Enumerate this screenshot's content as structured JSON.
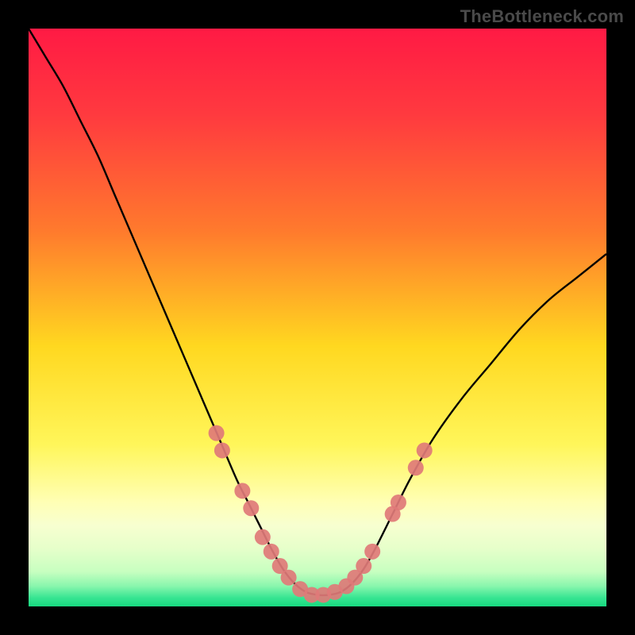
{
  "watermark": "TheBottleneck.com",
  "chart_data": {
    "type": "line",
    "title": "",
    "xlabel": "",
    "ylabel": "",
    "xlim": [
      0,
      100
    ],
    "ylim": [
      0,
      100
    ],
    "grid": false,
    "legend": false,
    "gradient_stops": [
      {
        "offset": 0.0,
        "color": "#ff1a44"
      },
      {
        "offset": 0.15,
        "color": "#ff3a3f"
      },
      {
        "offset": 0.35,
        "color": "#ff7a2d"
      },
      {
        "offset": 0.55,
        "color": "#ffd820"
      },
      {
        "offset": 0.72,
        "color": "#fff65a"
      },
      {
        "offset": 0.82,
        "color": "#ffffb5"
      },
      {
        "offset": 0.86,
        "color": "#f7ffd0"
      },
      {
        "offset": 0.9,
        "color": "#e6ffca"
      },
      {
        "offset": 0.94,
        "color": "#c7ffc0"
      },
      {
        "offset": 0.965,
        "color": "#88f6ad"
      },
      {
        "offset": 0.985,
        "color": "#37e592"
      },
      {
        "offset": 1.0,
        "color": "#17d97f"
      }
    ],
    "series": [
      {
        "name": "bottleneck-curve",
        "color": "#000000",
        "x": [
          0,
          3,
          6,
          9,
          12,
          15,
          18,
          21,
          24,
          27,
          30,
          33,
          36,
          38,
          40,
          42,
          44,
          46,
          48,
          50,
          52,
          54,
          56,
          58,
          60,
          63,
          66,
          70,
          75,
          80,
          85,
          90,
          95,
          100
        ],
        "y": [
          100,
          95,
          90,
          84,
          78,
          71,
          64,
          57,
          50,
          43,
          36,
          29,
          22,
          18,
          14,
          10,
          6.5,
          4,
          2.5,
          2,
          2,
          2.5,
          4,
          6.5,
          10,
          16,
          22,
          29,
          36,
          42,
          48,
          53,
          57,
          61
        ]
      },
      {
        "name": "marker-dots",
        "type": "scatter",
        "color": "#e07a78",
        "radius": 10,
        "x": [
          32.5,
          33.5,
          37,
          38.5,
          40.5,
          42,
          43.5,
          45,
          47,
          49,
          51,
          53,
          55,
          56.5,
          58,
          59.5,
          63,
          64,
          67,
          68.5
        ],
        "y": [
          30,
          27,
          20,
          17,
          12,
          9.5,
          7,
          5,
          3,
          2,
          2,
          2.5,
          3.5,
          5,
          7,
          9.5,
          16,
          18,
          24,
          27
        ]
      }
    ]
  }
}
